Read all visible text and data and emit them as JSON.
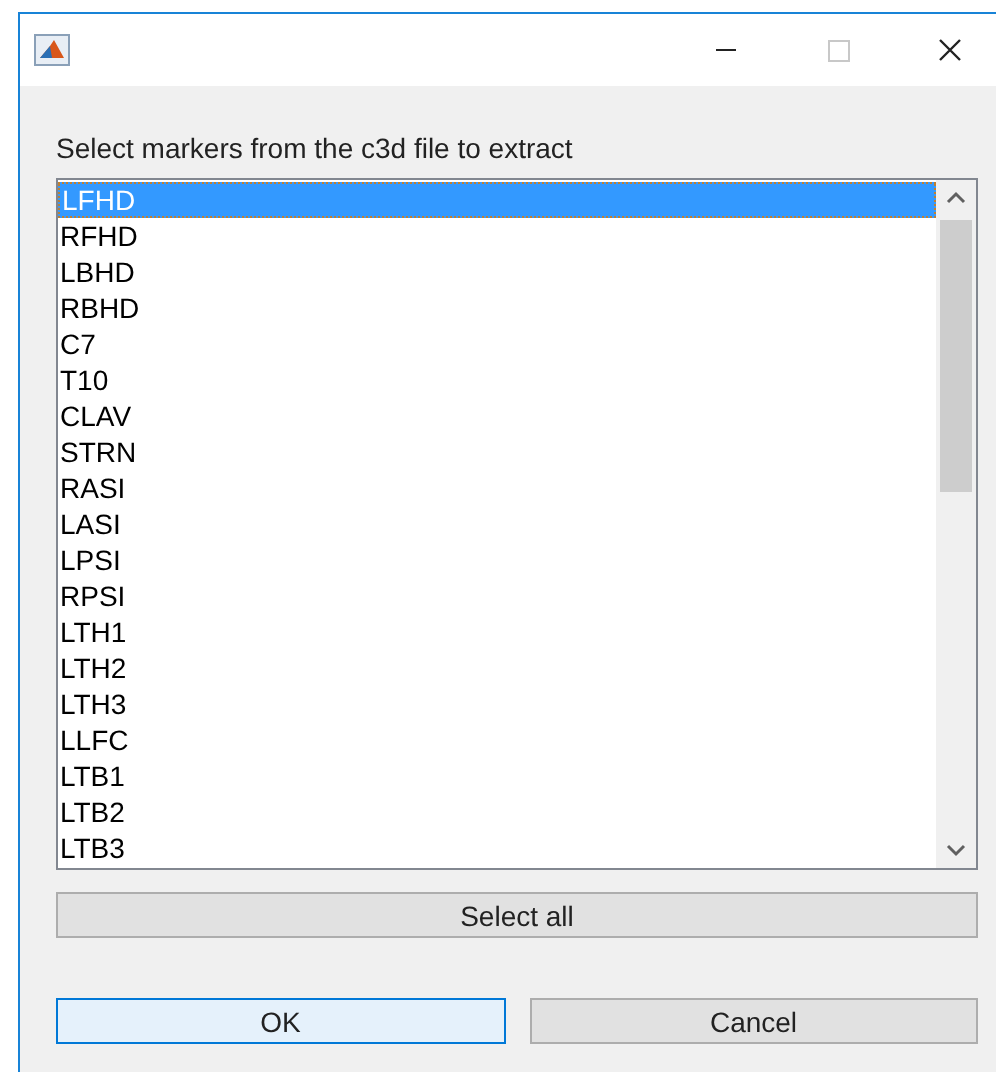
{
  "window": {
    "controls": [
      {
        "kind": "minimize"
      },
      {
        "kind": "maximize"
      },
      {
        "kind": "close"
      }
    ]
  },
  "prompt": "Select markers from the c3d file to extract",
  "markers": [
    {
      "label": "LFHD",
      "selected": true
    },
    {
      "label": "RFHD",
      "selected": false
    },
    {
      "label": "LBHD",
      "selected": false
    },
    {
      "label": "RBHD",
      "selected": false
    },
    {
      "label": "C7",
      "selected": false
    },
    {
      "label": "T10",
      "selected": false
    },
    {
      "label": "CLAV",
      "selected": false
    },
    {
      "label": "STRN",
      "selected": false
    },
    {
      "label": "RASI",
      "selected": false
    },
    {
      "label": "LASI",
      "selected": false
    },
    {
      "label": "LPSI",
      "selected": false
    },
    {
      "label": "RPSI",
      "selected": false
    },
    {
      "label": "LTH1",
      "selected": false
    },
    {
      "label": "LTH2",
      "selected": false
    },
    {
      "label": "LTH3",
      "selected": false
    },
    {
      "label": "LLFC",
      "selected": false
    },
    {
      "label": "LTB1",
      "selected": false
    },
    {
      "label": "LTB2",
      "selected": false
    },
    {
      "label": "LTB3",
      "selected": false
    }
  ],
  "select_all_button": "Select all",
  "buttons": [
    {
      "label": "OK",
      "selected": true
    },
    {
      "label": "Cancel",
      "selected": false
    }
  ]
}
